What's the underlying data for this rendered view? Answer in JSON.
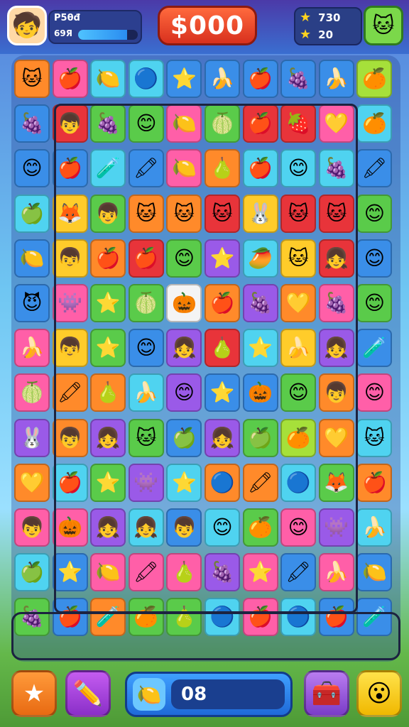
{
  "topbar": {
    "avatar_icon": "boy-face-icon",
    "player_name": "P5θđ",
    "player_level": "69Я",
    "progress": 0.82,
    "coins": "$000",
    "goal1_value": "730",
    "goal2_value": "20",
    "shop_icon": "cat-icon"
  },
  "bottombar": {
    "moves_value": "08",
    "star_button_icon": "star-icon",
    "pencil_button_icon": "pencil-icon",
    "moves_icon": "fruit-icon",
    "box_button_icon": "box-icon",
    "face_button_icon": "smiley-icon"
  },
  "colors": {
    "accent_red": "#d8301e",
    "accent_blue": "#1f6ad8",
    "frame": "#1c2340"
  },
  "board": {
    "rows": [
      [
        "orange:🐱",
        "pink:🍎",
        "cyan:🍋",
        "cyan:🔵",
        "blue:⭐",
        "blue:🍌",
        "blue:🍎",
        "blue:🍇",
        "blue:🍌",
        "lime:🍊"
      ],
      [
        "blue:🍇",
        "red:👦",
        "green:🍇",
        "green:😊",
        "pink:🍋",
        "green:🍈",
        "red:🍎",
        "red:🍓",
        "pink:💛",
        "cyan:🍊"
      ],
      [
        "blue:😊",
        "blue:🍎",
        "cyan:🧪",
        "blue:🖍",
        "pink:🍋",
        "orange:🍐",
        "cyan:🍎",
        "cyan:😊",
        "cyan:🍇",
        "blue:🖍"
      ],
      [
        "cyan:🍏",
        "yellow:🦊",
        "green:👦",
        "orange:🐱",
        "orange:🐱",
        "red:🐱",
        "yellow:🐰",
        "red:🐱",
        "red:🐱",
        "green:😊"
      ],
      [
        "blue:🍋",
        "yellow:👦",
        "orange:🍎",
        "red:🍎",
        "green:😊",
        "purple:⭐",
        "cyan:🥭",
        "yellow:🐱",
        "red:👧",
        "blue:😊"
      ],
      [
        "blue:😈",
        "pink:👾",
        "green:⭐",
        "green:🍈",
        "white:🎃",
        "orange:🍎",
        "purple:🍇",
        "orange:💛",
        "pink:🍇",
        "green:😊"
      ],
      [
        "pink:🍌",
        "yellow:👦",
        "green:⭐",
        "blue:😊",
        "purple:👧",
        "red:🍐",
        "cyan:⭐",
        "yellow:🍌",
        "purple:👧",
        "blue:🧪"
      ],
      [
        "pink:🍈",
        "orange:🖍",
        "orange:🍐",
        "cyan:🍌",
        "purple:😊",
        "blue:⭐",
        "blue:🎃",
        "green:😊",
        "orange:👦",
        "pink:😊"
      ],
      [
        "purple:🐰",
        "orange:👦",
        "purple:👧",
        "green:🐱",
        "blue:🍏",
        "purple:👧",
        "green:🍏",
        "lime:🍊",
        "orange:💛",
        "cyan:🐱"
      ],
      [
        "orange:💛",
        "cyan:🍎",
        "green:⭐",
        "purple:👾",
        "cyan:⭐",
        "orange:🔵",
        "orange:🖍",
        "cyan:🔵",
        "green:🦊",
        "orange:🍎"
      ],
      [
        "pink:👦",
        "pink:🎃",
        "purple:👧",
        "cyan:👧",
        "blue:👦",
        "cyan:😊",
        "green:🍊",
        "pink:😊",
        "purple:👾",
        "cyan:🍌"
      ],
      [
        "cyan:🍏",
        "blue:⭐",
        "pink:🍋",
        "pink:🖍",
        "pink:🍐",
        "purple:🍇",
        "pink:⭐",
        "blue:🖍",
        "pink:🍌",
        "blue:🍋"
      ],
      [
        "green:🍇",
        "blue:🍎",
        "orange:🧪",
        "green:🍊",
        "green:🍐",
        "cyan:🔵",
        "pink:🍎",
        "cyan:🔵",
        "blue:🍎",
        "blue:🧪"
      ]
    ]
  }
}
